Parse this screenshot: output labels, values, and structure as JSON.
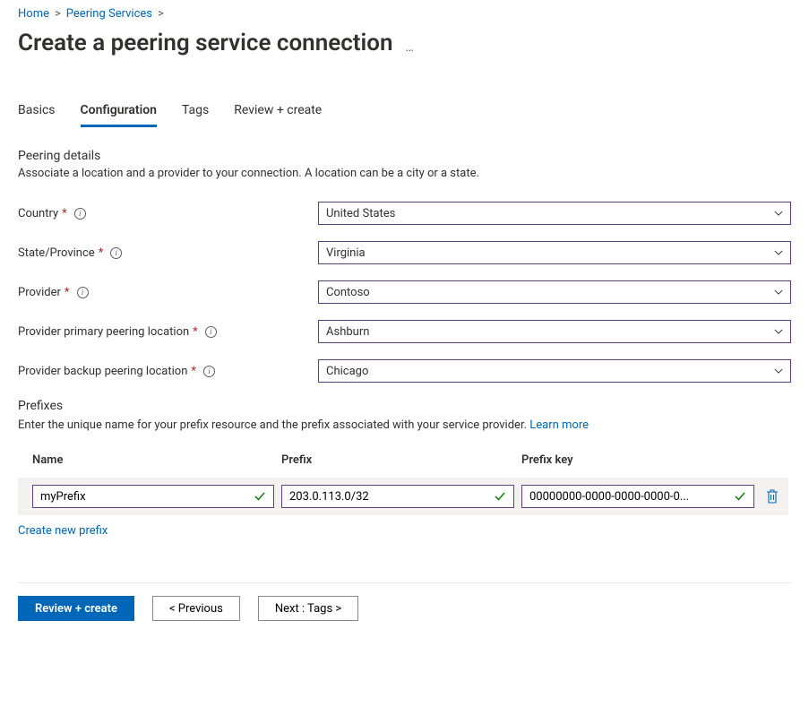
{
  "breadcrumb": {
    "items": [
      "Home",
      "Peering Services"
    ]
  },
  "page": {
    "title": "Create a peering service connection"
  },
  "tabs": [
    {
      "label": "Basics",
      "active": false
    },
    {
      "label": "Configuration",
      "active": true
    },
    {
      "label": "Tags",
      "active": false
    },
    {
      "label": "Review + create",
      "active": false
    }
  ],
  "peeringDetails": {
    "title": "Peering details",
    "description": "Associate a location and a provider to your connection. A location can be a city or a state.",
    "fields": {
      "country": {
        "label": "Country",
        "value": "United States"
      },
      "state": {
        "label": "State/Province",
        "value": "Virginia"
      },
      "provider": {
        "label": "Provider",
        "value": "Contoso"
      },
      "primaryLocation": {
        "label": "Provider primary peering location",
        "value": "Ashburn"
      },
      "backupLocation": {
        "label": "Provider backup peering location",
        "value": "Chicago"
      }
    }
  },
  "prefixes": {
    "title": "Prefixes",
    "description": "Enter the unique name for your prefix resource and the prefix associated with your service provider. ",
    "learnMore": "Learn more",
    "columns": {
      "name": "Name",
      "prefix": "Prefix",
      "key": "Prefix key"
    },
    "rows": [
      {
        "name": "myPrefix",
        "prefix": "203.0.113.0/32",
        "key": "00000000-0000-0000-0000-0..."
      }
    ],
    "createLink": "Create new prefix"
  },
  "footer": {
    "reviewCreate": "Review + create",
    "previous": "< Previous",
    "next": "Next : Tags >"
  }
}
